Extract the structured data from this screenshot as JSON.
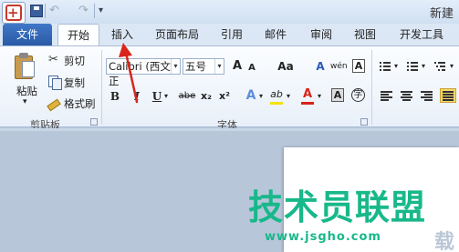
{
  "window": {
    "title": "新建"
  },
  "quick_access": {
    "save": "save-icon",
    "undo": "↶",
    "redo": "↷",
    "customize": "▾"
  },
  "tabs": [
    {
      "label": "文件"
    },
    {
      "label": "开始"
    },
    {
      "label": "插入"
    },
    {
      "label": "页面布局"
    },
    {
      "label": "引用"
    },
    {
      "label": "邮件"
    },
    {
      "label": "审阅"
    },
    {
      "label": "视图"
    },
    {
      "label": "开发工具"
    }
  ],
  "clipboard": {
    "label": "剪贴板",
    "paste": "粘贴",
    "paste_arrow": "▾",
    "cut": "剪切",
    "copy": "复制",
    "format_painter": "格式刷"
  },
  "font": {
    "label": "字体",
    "name": "Calibri (西文正",
    "size": "五号",
    "grow": "A",
    "shrink": "A",
    "case": "Aa",
    "clear": "A",
    "phonetic": "wén",
    "charborder": "A",
    "bold": "B",
    "italic": "I",
    "underline": "U",
    "strike": "abe",
    "subscript": "x₂",
    "superscript": "x²",
    "effects": "A",
    "highlight": "ab",
    "color": "A",
    "shade": "A",
    "enclose": "字",
    "highlight_color": "#f2e400",
    "font_color": "#d8231a"
  },
  "paragraph": {
    "bullets": "bullet-list-icon",
    "numbering": "numbered-list-icon",
    "multilevel": "multilevel-list-icon"
  },
  "annotation": {
    "arrow_color": "#d9251c"
  },
  "watermark": {
    "title": "技术员联盟",
    "url": "www.jsgho.com",
    "corner": "载"
  }
}
